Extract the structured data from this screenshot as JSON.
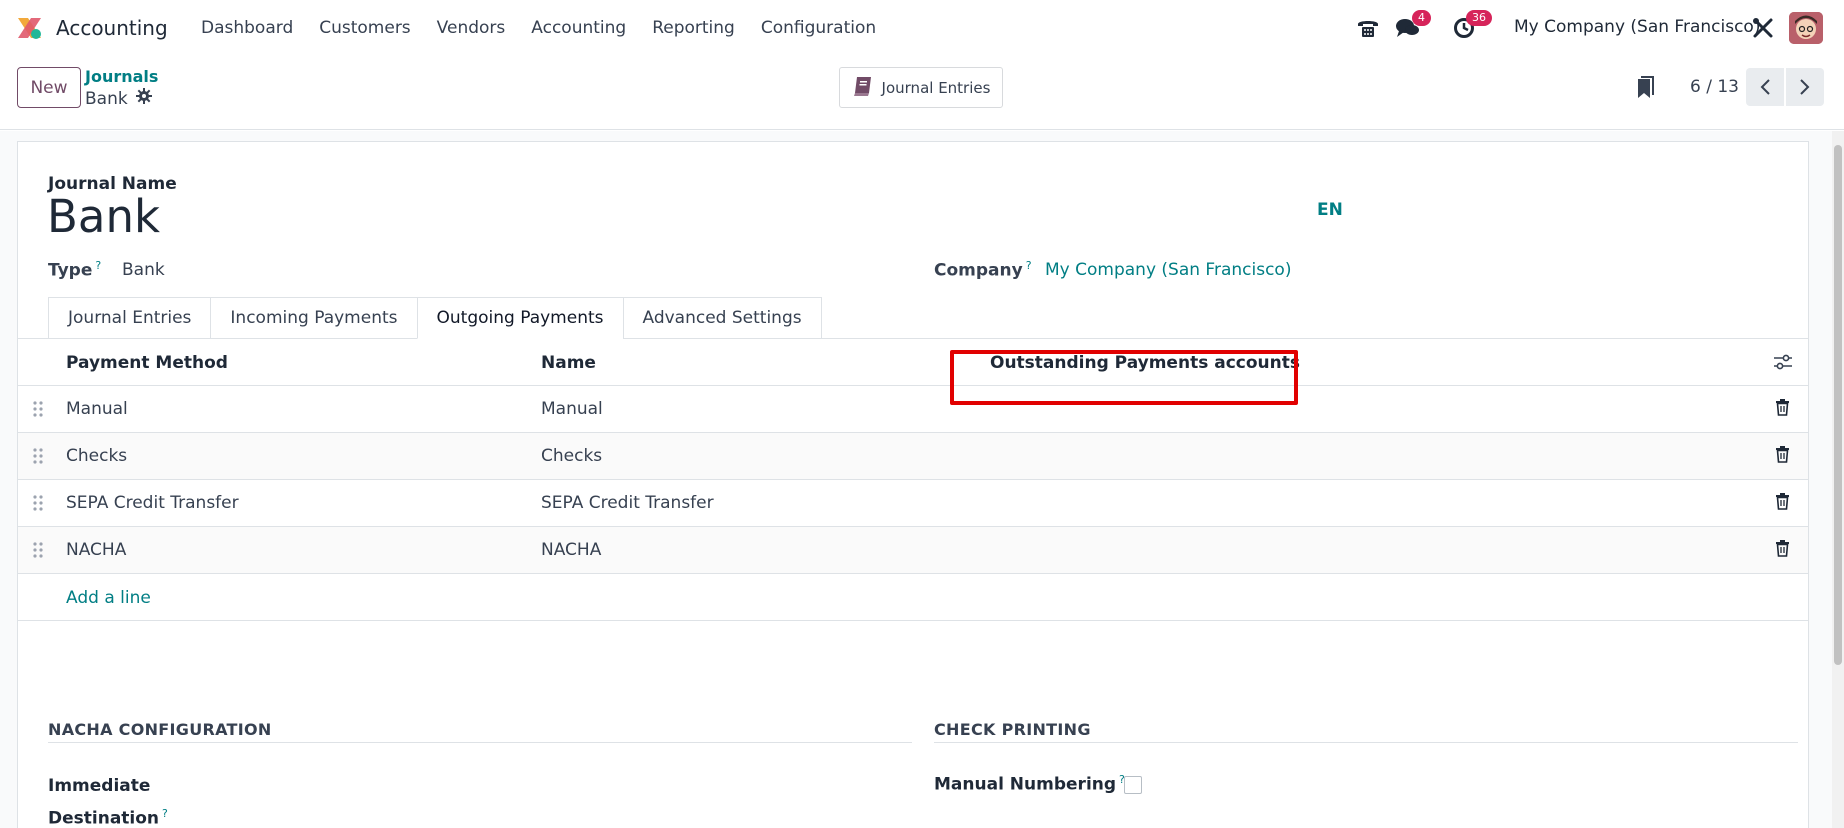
{
  "navbar": {
    "app_name": "Accounting",
    "menu": [
      "Dashboard",
      "Customers",
      "Vendors",
      "Accounting",
      "Reporting",
      "Configuration"
    ],
    "messages_badge": "4",
    "activities_badge": "36",
    "company": "My Company (San Francisco)"
  },
  "control_panel": {
    "new_label": "New",
    "breadcrumb_parent": "Journals",
    "breadcrumb_current": "Bank",
    "smart_button_label": "Journal Entries",
    "pager_value": "6 / 13"
  },
  "form": {
    "journal_name_label": "Journal Name",
    "journal_name": "Bank",
    "language": "EN",
    "type_label": "Type",
    "type_value": "Bank",
    "company_label": "Company",
    "company_value": "My Company (San Francisco)",
    "help_mark": "?"
  },
  "tabs": [
    "Journal Entries",
    "Incoming Payments",
    "Outgoing Payments",
    "Advanced Settings"
  ],
  "active_tab": "Outgoing Payments",
  "table": {
    "headers": [
      "Payment Method",
      "Name",
      "Outstanding Payments accounts"
    ],
    "rows": [
      {
        "method": "Manual",
        "name": "Manual"
      },
      {
        "method": "Checks",
        "name": "Checks"
      },
      {
        "method": "SEPA Credit Transfer",
        "name": "SEPA Credit Transfer"
      },
      {
        "method": "NACHA",
        "name": "NACHA"
      }
    ],
    "add_line": "Add a line"
  },
  "sections": {
    "nacha_title": "NACHA CONFIGURATION",
    "immediate_line1": "Immediate",
    "immediate_line2": "Destination",
    "check_title": "CHECK PRINTING",
    "manual_numbering": "Manual Numbering"
  },
  "colors": {
    "brand": "#714b67",
    "link": "#017e84",
    "badge": "#d6245a",
    "highlight": "#e10000"
  }
}
